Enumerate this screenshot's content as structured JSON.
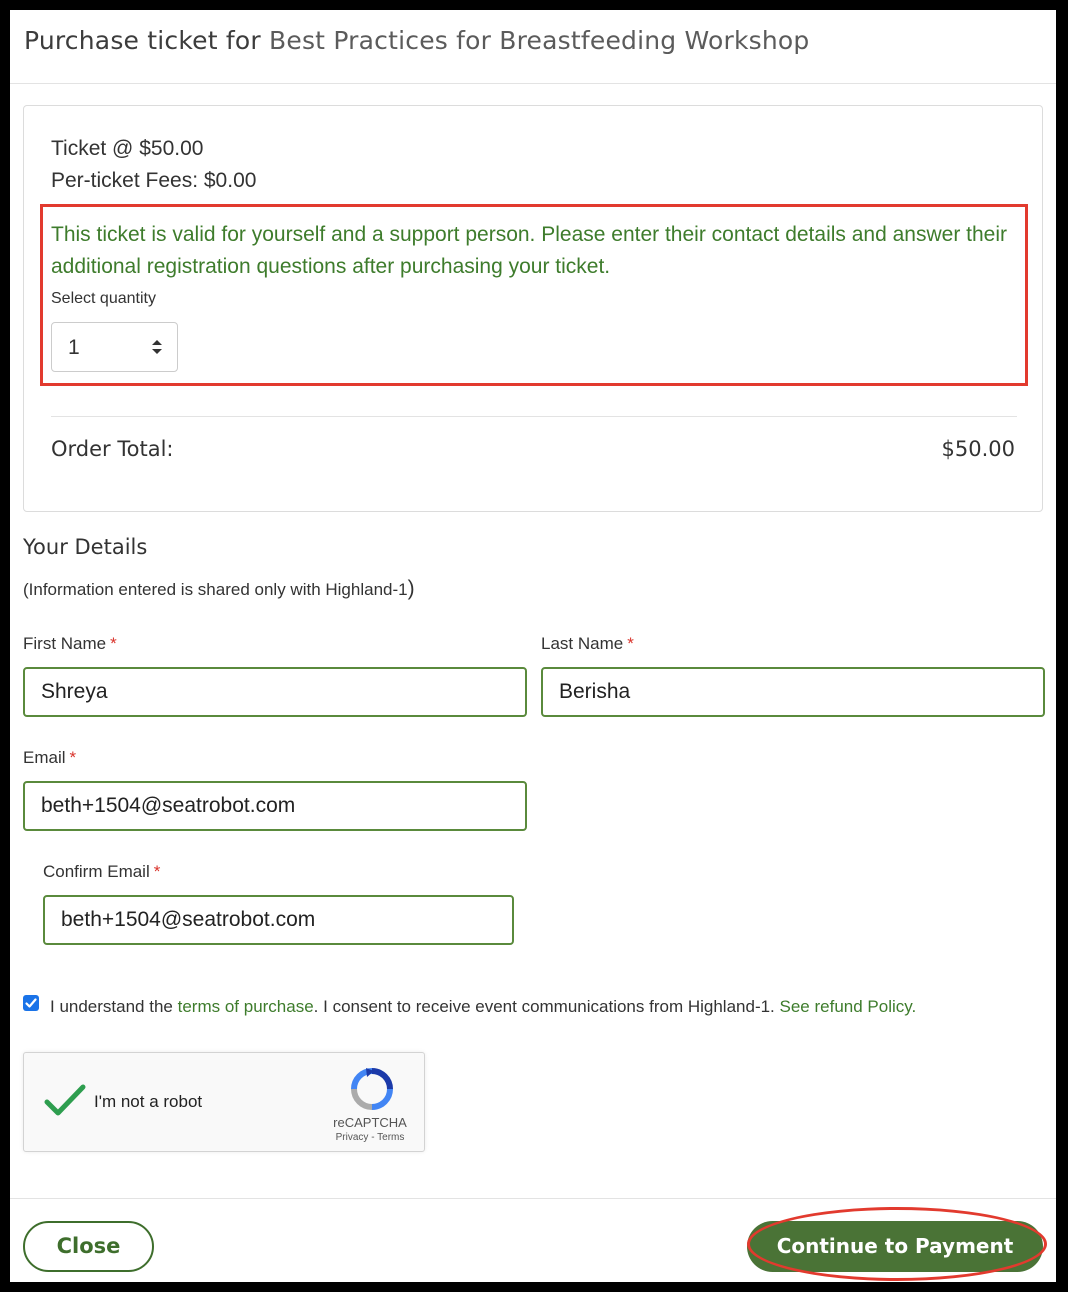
{
  "modal": {
    "title_prefix": "Purchase ticket for",
    "event_name": "Best Practices for Breastfeeding Workshop"
  },
  "ticket": {
    "price_line": "Ticket @ $50.00",
    "fees_line": "Per-ticket Fees: $0.00",
    "note": "This ticket is valid for yourself and a support person. Please enter their contact details and answer their additional registration questions after purchasing your ticket.",
    "quantity_label": "Select quantity",
    "quantity_value": "1",
    "order_total_label": "Order Total:",
    "order_total_value": "$50.00"
  },
  "details": {
    "title": "Your Details",
    "note_text": "(Information entered is shared only with Highland-1",
    "note_close": ")",
    "first_name_label": "First Name",
    "first_name_value": "Shreya",
    "last_name_label": "Last Name",
    "last_name_value": "Berisha",
    "email_label": "Email",
    "email_value": "beth+1504@seatrobot.com",
    "confirm_email_label": "Confirm Email",
    "confirm_email_value": "beth+1504@seatrobot.com",
    "required_mark": "*"
  },
  "consent": {
    "checked": true,
    "text_before": "I understand the",
    "terms_link": "terms of purchase",
    "text_middle": ". I consent to receive event communications from Highland-1.",
    "refund_link": "See refund Policy."
  },
  "captcha": {
    "label": "I'm not a robot",
    "brand": "reCAPTCHA",
    "links": "Privacy - Terms"
  },
  "footer": {
    "close_label": "Close",
    "pay_label": "Continue to Payment"
  },
  "colors": {
    "accent_green": "#3e7c2c",
    "button_green": "#4a7336",
    "annotation_red": "#e23a2e"
  }
}
